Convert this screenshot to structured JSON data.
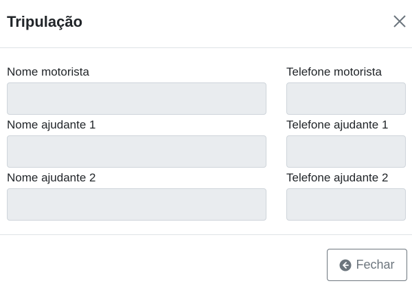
{
  "modal": {
    "title": "Tripulação",
    "close_icon": "close-icon"
  },
  "fields": {
    "nome_motorista": {
      "label": "Nome motorista",
      "value": ""
    },
    "telefone_motorista": {
      "label": "Telefone motorista",
      "value": ""
    },
    "nome_ajudante_1": {
      "label": "Nome ajudante 1",
      "value": ""
    },
    "telefone_ajudante_1": {
      "label": "Telefone ajudante 1",
      "value": ""
    },
    "nome_ajudante_2": {
      "label": "Nome ajudante 2",
      "value": ""
    },
    "telefone_ajudante_2": {
      "label": "Telefone ajudante 2",
      "value": ""
    }
  },
  "footer": {
    "close_label": "Fechar",
    "close_button_icon": "arrow-left-circle-icon"
  },
  "colors": {
    "input_background": "#e9ecef",
    "button_secondary": "#6c757d"
  }
}
